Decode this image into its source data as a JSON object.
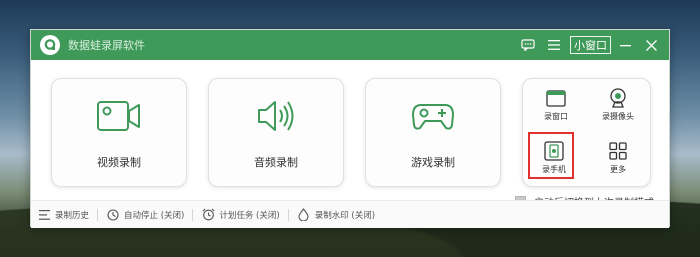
{
  "app": {
    "title": "数据蛙录屏软件",
    "mini_window_label": "小窗口"
  },
  "main_cards": [
    {
      "label": "视频录制",
      "icon": "video-camera-icon"
    },
    {
      "label": "音频录制",
      "icon": "speaker-icon"
    },
    {
      "label": "游戏录制",
      "icon": "gamepad-icon"
    }
  ],
  "small_items": [
    {
      "label": "录窗口",
      "icon": "window-icon"
    },
    {
      "label": "录摄像头",
      "icon": "webcam-icon"
    },
    {
      "label": "录手机",
      "icon": "phone-icon"
    },
    {
      "label": "更多",
      "icon": "grid-icon"
    }
  ],
  "restore_option": {
    "label": "启动后切换到上次录制模式",
    "checked": false
  },
  "footer": [
    {
      "label": "录制历史",
      "icon": "list-icon"
    },
    {
      "label": "自动停止 (关闭)",
      "icon": "clock-icon"
    },
    {
      "label": "计划任务 (关闭)",
      "icon": "alarm-icon"
    },
    {
      "label": "录制水印 (关闭)",
      "icon": "drop-icon"
    }
  ],
  "colors": {
    "accent": "#3f9a5a",
    "highlight": "#e0312f"
  }
}
